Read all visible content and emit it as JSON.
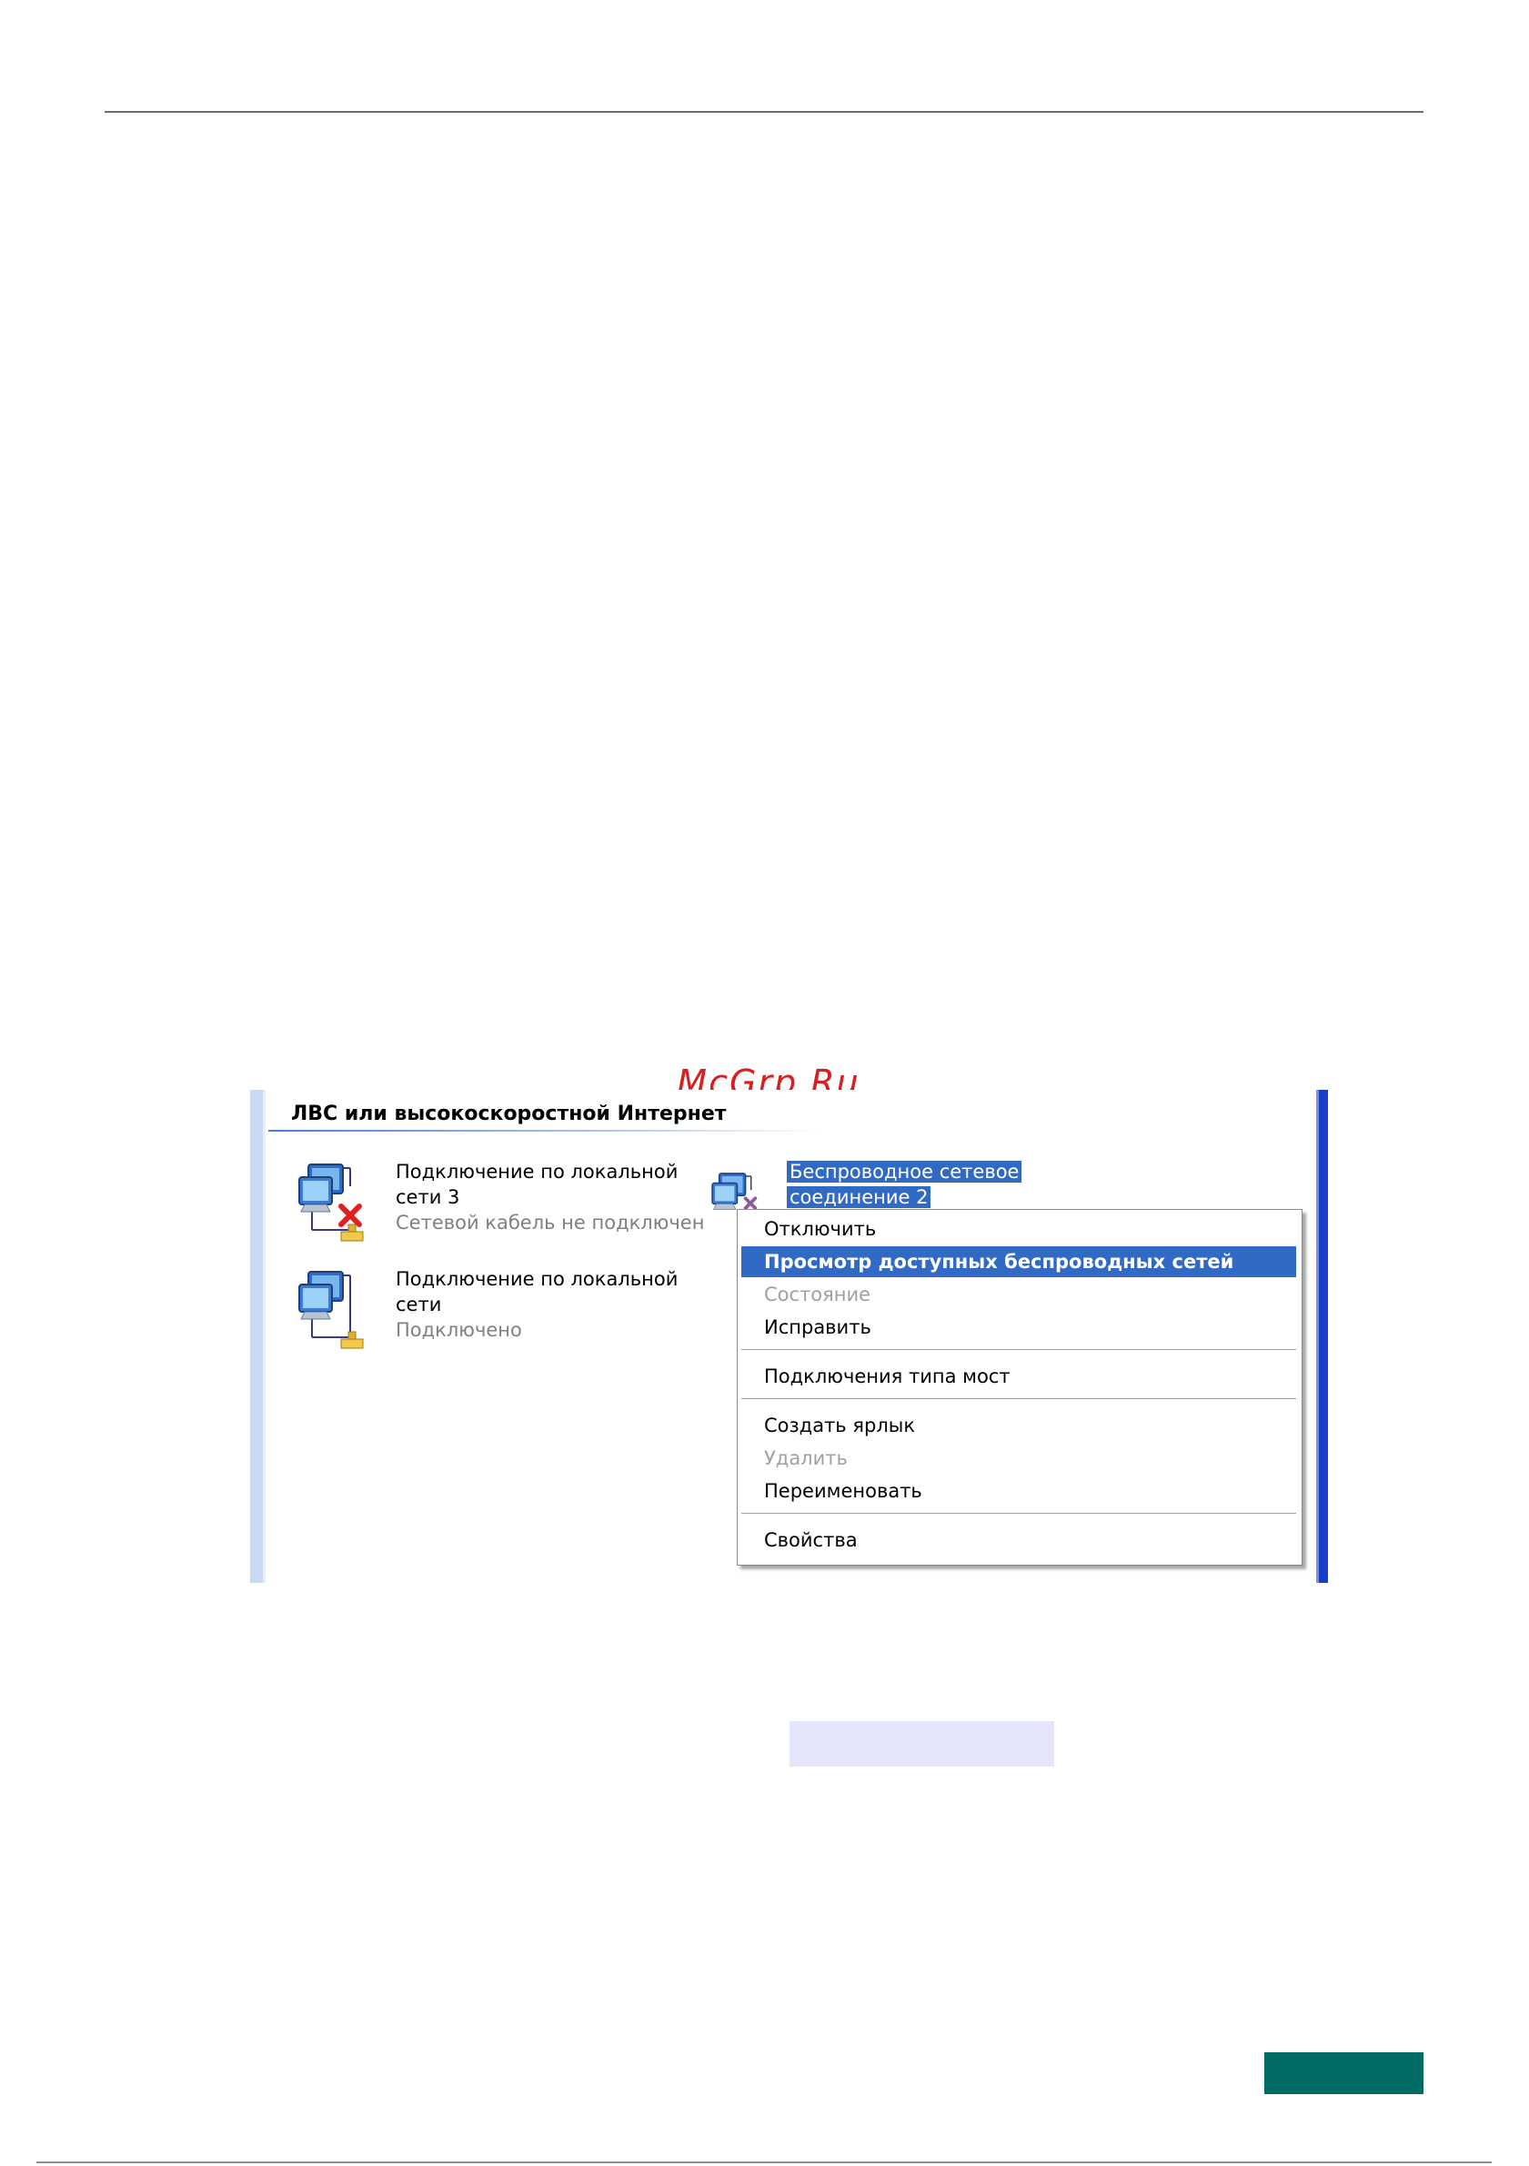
{
  "watermark": "McGrp.Ru",
  "screenshot": {
    "group_title": "ЛВС или высокоскоростной Интернет",
    "connections": [
      {
        "name_line1": "Подключение по локальной",
        "name_line2": "сети 3",
        "status": "Сетевой кабель не подключен",
        "icon": "network-connection-disconnected-icon"
      },
      {
        "name_line1": "Подключение по локальной",
        "name_line2": "сети",
        "status": "Подключено",
        "icon": "network-connection-icon"
      },
      {
        "name_line1": "Беспроводное сетевое",
        "name_line2": "соединение 2",
        "icon": "wireless-connection-disabled-icon"
      }
    ],
    "context_menu": {
      "items": [
        {
          "label": "Отключить",
          "state": "normal"
        },
        {
          "label": "Просмотр доступных беспроводных сетей",
          "state": "highlighted"
        },
        {
          "label": "Состояние",
          "state": "disabled"
        },
        {
          "label": "Исправить",
          "state": "normal"
        },
        {
          "label": "Подключения типа мост",
          "state": "normal"
        },
        {
          "label": "Создать ярлык",
          "state": "normal"
        },
        {
          "label": "Удалить",
          "state": "disabled"
        },
        {
          "label": "Переименовать",
          "state": "normal"
        },
        {
          "label": "Свойства",
          "state": "normal"
        }
      ]
    }
  },
  "colors": {
    "selection": "#316ac5",
    "footer_badge": "#006b64",
    "highlight_box": "#e6e6fa",
    "watermark": "#d81e1e"
  }
}
